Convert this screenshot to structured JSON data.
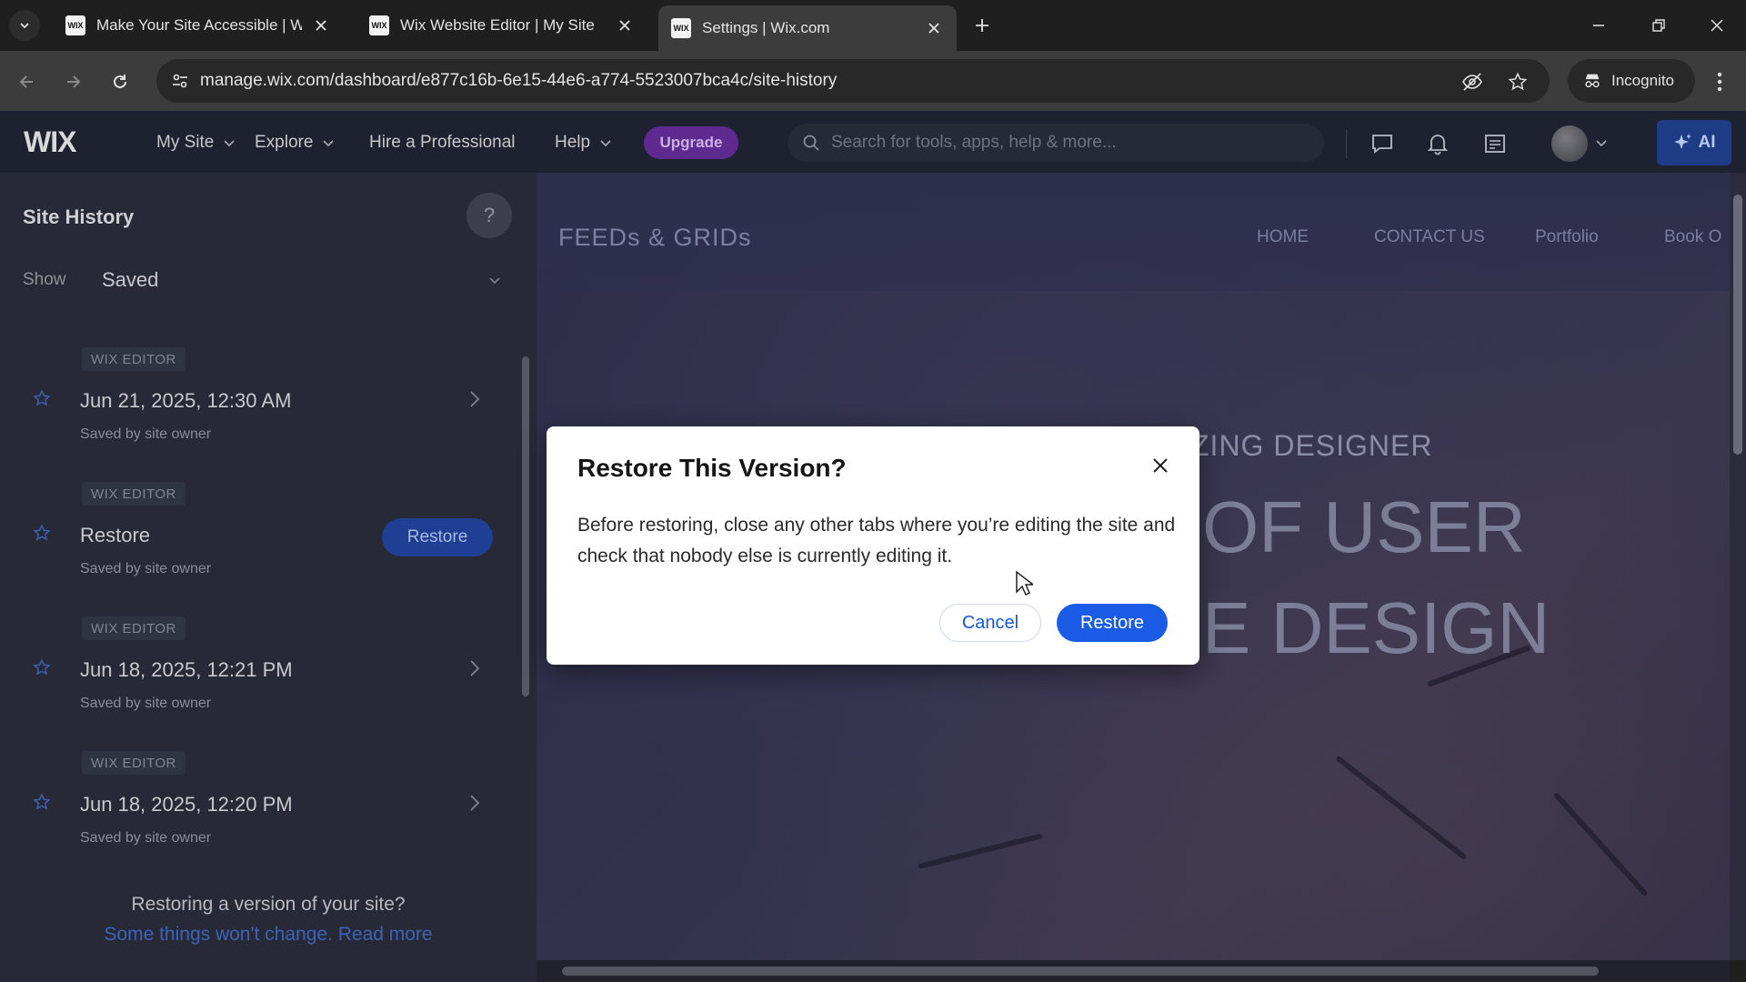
{
  "browser": {
    "tabs": [
      {
        "title": "Make Your Site Accessible | Wix",
        "favicon": "WIX"
      },
      {
        "title": "Wix Website Editor | My Site",
        "favicon": "WIX"
      },
      {
        "title": "Settings | Wix.com",
        "favicon": "WIX"
      }
    ],
    "url": "manage.wix.com/dashboard/e877c16b-6e15-44e6-a774-5523007bca4c/site-history",
    "incognito_label": "Incognito"
  },
  "wix": {
    "logo": "WIX",
    "nav": {
      "my_site": "My Site",
      "explore": "Explore",
      "hire": "Hire a Professional",
      "help": "Help"
    },
    "upgrade": "Upgrade",
    "search_placeholder": "Search for tools, apps, help & more...",
    "ai_label": "AI"
  },
  "site_history": {
    "title": "Site History",
    "help_icon": "?",
    "show_label": "Show",
    "show_value": "Saved",
    "entries": [
      {
        "badge": "WIX EDITOR",
        "title": "Jun 21, 2025, 12:30 AM",
        "by": "Saved by site owner"
      },
      {
        "badge": "WIX EDITOR",
        "title": "Restore",
        "by": "Saved by site owner",
        "button": "Restore"
      },
      {
        "badge": "WIX EDITOR",
        "title": "Jun 18, 2025, 12:21 PM",
        "by": "Saved by site owner"
      },
      {
        "badge": "WIX EDITOR",
        "title": "Jun 18, 2025, 12:20 PM",
        "by": "Saved by site owner"
      }
    ],
    "footer_question": "Restoring a version of your site?",
    "footer_link": "Some things won't change. Read more"
  },
  "preview": {
    "logo": "FEEDs & GRIDs",
    "nav": [
      "HOME",
      "CONTACT US",
      "Portfolio",
      "Book O"
    ],
    "subtitle": "ZING DESIGNER",
    "headline_1": "OF USER",
    "headline_2": "E DESIGN"
  },
  "modal": {
    "title": "Restore This Version?",
    "body": "Before restoring, close any other tabs where you’re editing the site and check that nobody else is currently editing it.",
    "cancel": "Cancel",
    "restore": "Restore"
  },
  "colors": {
    "accent_blue": "#1a5ce6",
    "upgrade_purple": "#5f2a8f",
    "wix_bar": "#1d2130"
  }
}
